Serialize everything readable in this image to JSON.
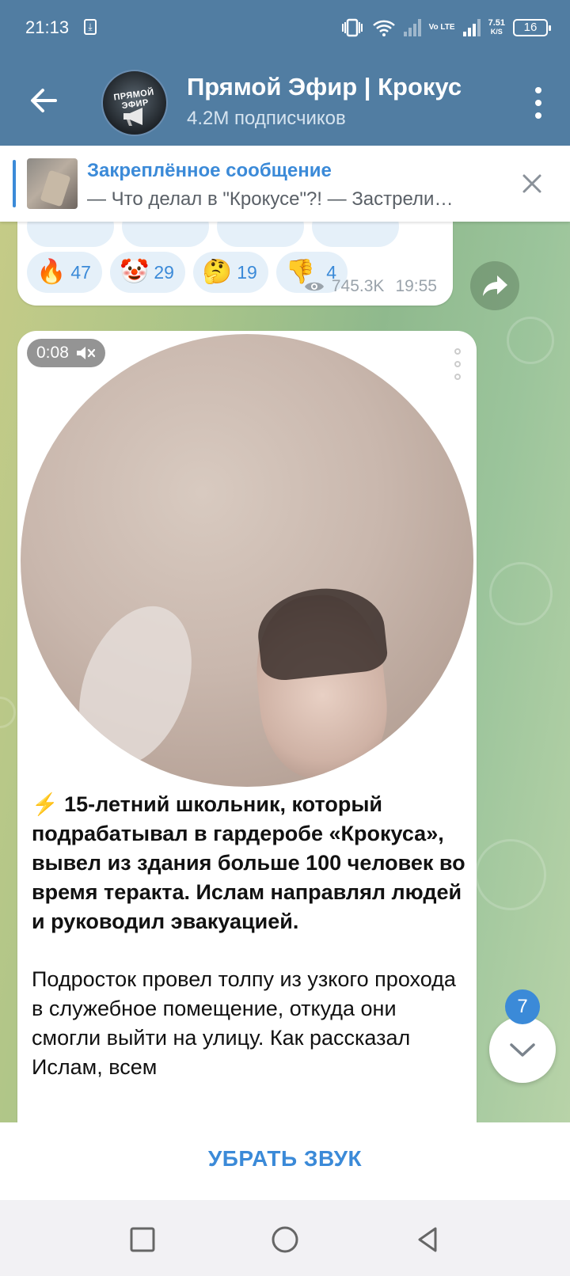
{
  "status_bar": {
    "time": "21:13",
    "download_icon": "⤓",
    "network": "Vo LTE",
    "speed_value": "7.51",
    "speed_unit": "K/S",
    "battery": "16"
  },
  "header": {
    "title": "Прямой Эфир | Крокус",
    "subtitle": "4.2M подписчиков",
    "avatar_text": "ПРЯМОЙ ЭФИР"
  },
  "pinned": {
    "title": "Закреплённое сообщение",
    "text": "— Что делал в \"Крокусе\"?! — Застрели…"
  },
  "post1": {
    "reactions": [
      {
        "emoji": "🔥",
        "count": "47"
      },
      {
        "emoji": "🤡",
        "count": "29"
      },
      {
        "emoji": "🤔",
        "count": "19"
      },
      {
        "emoji": "👎",
        "count": "4"
      }
    ],
    "views": "745.3K",
    "time": "19:55"
  },
  "post2": {
    "duration": "0:08",
    "text_bold": "⚡️ 15-летний школьник, который подрабатывал в гардеробе «Крокуса», вывел из здания больше 100 человек во время теракта. Ислам направлял людей и руководил эвакуацией.",
    "text_plain": "Подросток провел толпу из узкого прохода в служебное помещение, откуда они смогли выйти на улицу. Как рассказал Ислам, всем"
  },
  "scroll_badge": "7",
  "bottom_action": "УБРАТЬ ЗВУК",
  "colors": {
    "header": "#517da2",
    "accent": "#3b8ad8"
  }
}
